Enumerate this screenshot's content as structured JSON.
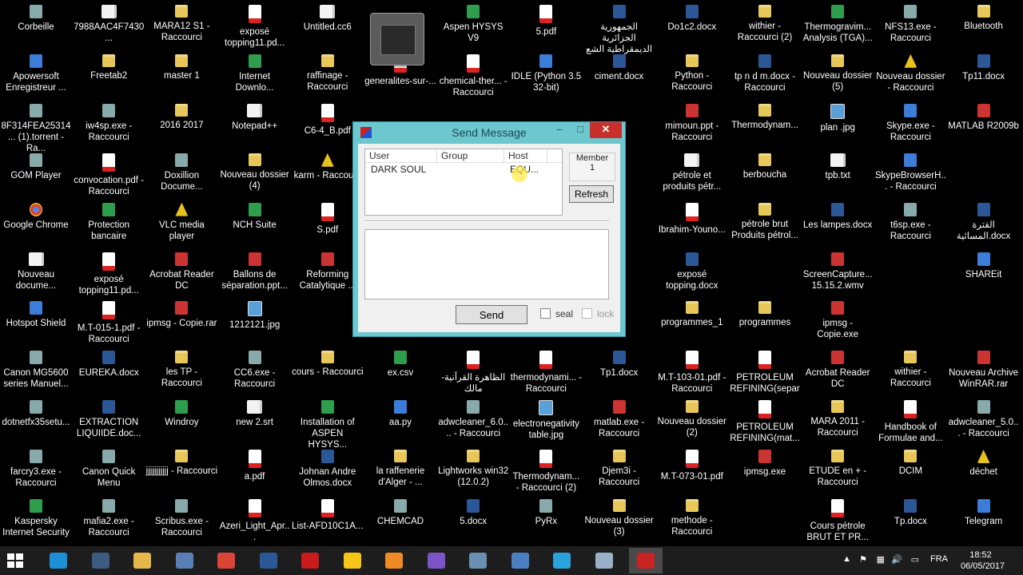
{
  "desktop_icons": [
    {
      "label": "Corbeille",
      "type": "exe",
      "col": 0,
      "row": 0
    },
    {
      "label": "7988AAC4F7430...",
      "type": "doc",
      "col": 1,
      "row": 0
    },
    {
      "label": "MARA12 S1 - Raccourci",
      "type": "folder",
      "col": 2,
      "row": 0
    },
    {
      "label": "exposé topping11.pd...",
      "type": "pdf",
      "col": 3,
      "row": 0
    },
    {
      "label": "Untitled.cc6",
      "type": "doc",
      "col": 4,
      "row": 0
    },
    {
      "label": "Aspen HYSYS V9",
      "type": "green",
      "col": 6,
      "row": 0
    },
    {
      "label": "5.pdf",
      "type": "pdf",
      "col": 7,
      "row": 0
    },
    {
      "label": "الجمهورية الجزائرية الديمقراطية الشع",
      "type": "word",
      "col": 8,
      "row": 0
    },
    {
      "label": "Do1c2.docx",
      "type": "word",
      "col": 9,
      "row": 0
    },
    {
      "label": "withier - Raccourci (2)",
      "type": "folder",
      "col": 10,
      "row": 0
    },
    {
      "label": "Thermogravim... Analysis (TGA)...",
      "type": "green",
      "col": 11,
      "row": 0
    },
    {
      "label": "NFS13.exe - Raccourci",
      "type": "exe",
      "col": 12,
      "row": 0
    },
    {
      "label": "Bluetooth",
      "type": "folder",
      "col": 13,
      "row": 0
    },
    {
      "label": "Apowersoft Enregistreur ...",
      "type": "app",
      "col": 0,
      "row": 1
    },
    {
      "label": "Freetab2",
      "type": "folder",
      "col": 1,
      "row": 1
    },
    {
      "label": "master 1",
      "type": "folder",
      "col": 2,
      "row": 1
    },
    {
      "label": "Internet Downlo...",
      "type": "green",
      "col": 3,
      "row": 1
    },
    {
      "label": "raffinage - Raccourci",
      "type": "folder",
      "col": 4,
      "row": 1
    },
    {
      "label": "generalites-sur-...",
      "type": "pdf",
      "col": 5,
      "row": 1
    },
    {
      "label": "chemical-ther... - Raccourci",
      "type": "pdf",
      "col": 6,
      "row": 1
    },
    {
      "label": "IDLE (Python 3.5 32-bit)",
      "type": "app",
      "col": 7,
      "row": 1
    },
    {
      "label": "ciment.docx",
      "type": "word",
      "col": 8,
      "row": 1
    },
    {
      "label": "Python - Raccourci",
      "type": "folder",
      "col": 9,
      "row": 1
    },
    {
      "label": "tp n d m.docx - Raccourci",
      "type": "word",
      "col": 10,
      "row": 1
    },
    {
      "label": "Nouveau dossier (5)",
      "type": "folder",
      "col": 11,
      "row": 1
    },
    {
      "label": "Nouveau dossier - Raccourci",
      "type": "warn",
      "col": 12,
      "row": 1
    },
    {
      "label": "Tp11.docx",
      "type": "word",
      "col": 13,
      "row": 1
    },
    {
      "label": "8F314FEA25314... (1).torrent - Ra...",
      "type": "exe",
      "col": 0,
      "row": 2
    },
    {
      "label": "iw4sp.exe - Raccourci",
      "type": "exe",
      "col": 1,
      "row": 2
    },
    {
      "label": "2016 2017",
      "type": "folder",
      "col": 2,
      "row": 2
    },
    {
      "label": "Notepad++",
      "type": "doc",
      "col": 3,
      "row": 2
    },
    {
      "label": "C6-4_B.pdf",
      "type": "pdf",
      "col": 4,
      "row": 2
    },
    {
      "label": "mimoun.ppt - Raccourci",
      "type": "red",
      "col": 9,
      "row": 2
    },
    {
      "label": "Thermodynam...",
      "type": "folder",
      "col": 10,
      "row": 2
    },
    {
      "label": "plan .jpg",
      "type": "img",
      "col": 11,
      "row": 2
    },
    {
      "label": "Skype.exe - Raccourci",
      "type": "app",
      "col": 12,
      "row": 2
    },
    {
      "label": "MATLAB R2009b",
      "type": "red",
      "col": 13,
      "row": 2
    },
    {
      "label": "GOM Player",
      "type": "exe",
      "col": 0,
      "row": 3
    },
    {
      "label": "convocation.pdf - Raccourci",
      "type": "pdf",
      "col": 1,
      "row": 3
    },
    {
      "label": "Doxillion Docume...",
      "type": "exe",
      "col": 2,
      "row": 3
    },
    {
      "label": "Nouveau dossier (4)",
      "type": "folder",
      "col": 3,
      "row": 3
    },
    {
      "label": "karm - Raccou...",
      "type": "warn",
      "col": 4,
      "row": 3
    },
    {
      "label": "pétrole et produits pétr...",
      "type": "doc",
      "col": 9,
      "row": 3
    },
    {
      "label": "berboucha",
      "type": "folder",
      "col": 10,
      "row": 3
    },
    {
      "label": "tpb.txt",
      "type": "doc",
      "col": 11,
      "row": 3
    },
    {
      "label": "SkypeBrowserH... - Raccourci",
      "type": "app",
      "col": 12,
      "row": 3
    },
    {
      "label": "Google Chrome",
      "type": "chrome",
      "col": 0,
      "row": 4
    },
    {
      "label": "Protection bancaire",
      "type": "green",
      "col": 1,
      "row": 4
    },
    {
      "label": "VLC media player",
      "type": "warn",
      "col": 2,
      "row": 4
    },
    {
      "label": "NCH Suite",
      "type": "green",
      "col": 3,
      "row": 4
    },
    {
      "label": "S.pdf",
      "type": "pdf",
      "col": 4,
      "row": 4
    },
    {
      "label": "Ibrahim-Youno...",
      "type": "pdf",
      "col": 9,
      "row": 4
    },
    {
      "label": "pétrole brut Produits pétrol...",
      "type": "folder",
      "col": 10,
      "row": 4
    },
    {
      "label": "Les lampes.docx",
      "type": "word",
      "col": 11,
      "row": 4
    },
    {
      "label": "t6sp.exe - Raccourci",
      "type": "exe",
      "col": 12,
      "row": 4
    },
    {
      "label": "القترة المسائية.docx",
      "type": "word",
      "col": 13,
      "row": 4
    },
    {
      "label": "Nouveau docume...",
      "type": "doc",
      "col": 0,
      "row": 5
    },
    {
      "label": "exposé topping11.pd...",
      "type": "pdf",
      "col": 1,
      "row": 5
    },
    {
      "label": "Acrobat Reader DC",
      "type": "red",
      "col": 2,
      "row": 5
    },
    {
      "label": "Ballons de séparation.ppt...",
      "type": "red",
      "col": 3,
      "row": 5
    },
    {
      "label": "Reforming Catalytique ...",
      "type": "red",
      "col": 4,
      "row": 5
    },
    {
      "label": "exposé topping.docx",
      "type": "word",
      "col": 9,
      "row": 5
    },
    {
      "label": "ScreenCapture... 15.15.2.wmv",
      "type": "red",
      "col": 11,
      "row": 5
    },
    {
      "label": "SHAREit",
      "type": "app",
      "col": 13,
      "row": 5
    },
    {
      "label": "Hotspot Shield",
      "type": "app",
      "col": 0,
      "row": 6
    },
    {
      "label": "M.T-015-1.pdf - Raccourci",
      "type": "pdf",
      "col": 1,
      "row": 6
    },
    {
      "label": "ipmsg - Copie.rar",
      "type": "red",
      "col": 2,
      "row": 6
    },
    {
      "label": "1212121.jpg",
      "type": "img",
      "col": 3,
      "row": 6
    },
    {
      "label": "programmes_1",
      "type": "folder",
      "col": 9,
      "row": 6
    },
    {
      "label": "programmes",
      "type": "folder",
      "col": 10,
      "row": 6
    },
    {
      "label": "ipmsg - Copie.exe",
      "type": "red",
      "col": 11,
      "row": 6
    },
    {
      "label": "Canon MG5600 series Manuel...",
      "type": "exe",
      "col": 0,
      "row": 7
    },
    {
      "label": "EUREKA.docx",
      "type": "word",
      "col": 1,
      "row": 7
    },
    {
      "label": "les TP - Raccourci",
      "type": "folder",
      "col": 2,
      "row": 7
    },
    {
      "label": "CC6.exe - Raccourci",
      "type": "exe",
      "col": 3,
      "row": 7
    },
    {
      "label": "cours - Raccourci",
      "type": "folder",
      "col": 4,
      "row": 7
    },
    {
      "label": "ex.csv",
      "type": "green",
      "col": 5,
      "row": 7
    },
    {
      "label": "الظاهرة القرآنية-مالك",
      "type": "pdf",
      "col": 6,
      "row": 7
    },
    {
      "label": "thermodynami... - Raccourci",
      "type": "pdf",
      "col": 7,
      "row": 7
    },
    {
      "label": "Tp1.docx",
      "type": "word",
      "col": 8,
      "row": 7
    },
    {
      "label": "M.T-103-01.pdf - Raccourci",
      "type": "pdf",
      "col": 9,
      "row": 7
    },
    {
      "label": "PETROLEUM REFINING(separ...",
      "type": "pdf",
      "col": 10,
      "row": 7
    },
    {
      "label": "Acrobat Reader DC",
      "type": "red",
      "col": 11,
      "row": 7
    },
    {
      "label": "withier - Raccourci",
      "type": "folder",
      "col": 12,
      "row": 7
    },
    {
      "label": "Nouveau Archive WinRAR.rar",
      "type": "red",
      "col": 13,
      "row": 7
    },
    {
      "label": "dotnetfx35setu...",
      "type": "exe",
      "col": 0,
      "row": 8
    },
    {
      "label": "EXTRACTION LIQUIIDE.doc...",
      "type": "word",
      "col": 1,
      "row": 8
    },
    {
      "label": "Windroy",
      "type": "green",
      "col": 2,
      "row": 8
    },
    {
      "label": "new 2.srt",
      "type": "doc",
      "col": 3,
      "row": 8
    },
    {
      "label": "Installation of ASPEN HYSYS...",
      "type": "green",
      "col": 4,
      "row": 8
    },
    {
      "label": "aa.py",
      "type": "app",
      "col": 5,
      "row": 8
    },
    {
      "label": "adwcleaner_6.0.... - Raccourci",
      "type": "exe",
      "col": 6,
      "row": 8
    },
    {
      "label": "electronegativity table.jpg",
      "type": "img",
      "col": 7,
      "row": 8
    },
    {
      "label": "matlab.exe - Raccourci",
      "type": "red",
      "col": 8,
      "row": 8
    },
    {
      "label": "Nouveau dossier (2)",
      "type": "folder",
      "col": 9,
      "row": 8
    },
    {
      "label": "PETROLEUM REFINING(mat...",
      "type": "pdf",
      "col": 10,
      "row": 8
    },
    {
      "label": "MARA 2011 - Raccourci",
      "type": "folder",
      "col": 11,
      "row": 8
    },
    {
      "label": "Handbook of Formulae and...",
      "type": "pdf",
      "col": 12,
      "row": 8
    },
    {
      "label": "adwcleaner_5.0... - Raccourci",
      "type": "exe",
      "col": 13,
      "row": 8
    },
    {
      "label": "farcry3.exe - Raccourci",
      "type": "exe",
      "col": 0,
      "row": 9
    },
    {
      "label": "Canon Quick Menu",
      "type": "exe",
      "col": 1,
      "row": 9
    },
    {
      "label": "jjjjjjjjjjj - Raccourci",
      "type": "folder",
      "col": 2,
      "row": 9
    },
    {
      "label": "a.pdf",
      "type": "pdf",
      "col": 3,
      "row": 9
    },
    {
      "label": "Johnan Andre Olmos.docx",
      "type": "word",
      "col": 4,
      "row": 9
    },
    {
      "label": "la raffenerie d'Alger - ...",
      "type": "folder",
      "col": 5,
      "row": 9
    },
    {
      "label": "Lightworks win32 (12.0.2)",
      "type": "folder",
      "col": 6,
      "row": 9
    },
    {
      "label": "Thermodynam... - Raccourci (2)",
      "type": "pdf",
      "col": 7,
      "row": 9
    },
    {
      "label": "Djem3i - Raccourci",
      "type": "folder",
      "col": 8,
      "row": 9
    },
    {
      "label": "M.T-073-01.pdf",
      "type": "pdf",
      "col": 9,
      "row": 9
    },
    {
      "label": "ipmsg.exe",
      "type": "red",
      "col": 10,
      "row": 9
    },
    {
      "label": "ETUDE en + - Raccourci",
      "type": "folder",
      "col": 11,
      "row": 9
    },
    {
      "label": "DCIM",
      "type": "folder",
      "col": 12,
      "row": 9
    },
    {
      "label": "déchet",
      "type": "warn",
      "col": 13,
      "row": 9
    },
    {
      "label": "Kaspersky Internet Security",
      "type": "green",
      "col": 0,
      "row": 10
    },
    {
      "label": "mafia2.exe - Raccourci",
      "type": "exe",
      "col": 1,
      "row": 10
    },
    {
      "label": "Scribus.exe - Raccourci",
      "type": "exe",
      "col": 2,
      "row": 10
    },
    {
      "label": "Azeri_Light_Apr...",
      "type": "pdf",
      "col": 3,
      "row": 10
    },
    {
      "label": "List-AFD10C1A...",
      "type": "pdf",
      "col": 4,
      "row": 10
    },
    {
      "label": "CHEMCAD",
      "type": "exe",
      "col": 5,
      "row": 10
    },
    {
      "label": "5.docx",
      "type": "word",
      "col": 6,
      "row": 10
    },
    {
      "label": "PyRx",
      "type": "exe",
      "col": 7,
      "row": 10
    },
    {
      "label": "Nouveau dossier (3)",
      "type": "folder",
      "col": 8,
      "row": 10
    },
    {
      "label": "methode - Raccourci",
      "type": "folder",
      "col": 9,
      "row": 10
    },
    {
      "label": "Cours pétrole BRUT ET PR...",
      "type": "pdf",
      "col": 11,
      "row": 10
    },
    {
      "label": "Tp.docx",
      "type": "word",
      "col": 12,
      "row": 10
    },
    {
      "label": "Telegram",
      "type": "app",
      "col": 13,
      "row": 10
    }
  ],
  "dialog": {
    "title": "Send Message",
    "minimize": "–",
    "maximize": "□",
    "close": "✕",
    "columns": [
      "User",
      "Group",
      "Host"
    ],
    "users": [
      {
        "user": "DARK SOUL",
        "group": "",
        "host": "EQU..."
      }
    ],
    "member_label": "Member",
    "member_count": "1",
    "refresh_label": "Refresh",
    "message_value": "",
    "send_label": "Send",
    "seal_label": "seal",
    "lock_label": "lock",
    "seal_checked": false,
    "lock_checked": false,
    "lock_enabled": false
  },
  "taskbar": {
    "apps": [
      "ie-icon",
      "fc3-icon",
      "file-explorer-icon",
      "remote-desktop-icon",
      "chrome-icon",
      "word-icon",
      "opera-icon",
      "python-icon",
      "utorrent-icon",
      "vlc-like-icon",
      "photo-viewer-icon",
      "control-panel-icon",
      "telegram-icon",
      "app-icon",
      "ipmsg-icon"
    ],
    "tray_language": "FRA",
    "time": "18:52",
    "date": "06/05/2017"
  },
  "colors": {
    "dialog_frame": "#6cc7cf",
    "close_button": "#c9302c",
    "taskbar": "#1d1d1d",
    "desktop": "#000000"
  }
}
